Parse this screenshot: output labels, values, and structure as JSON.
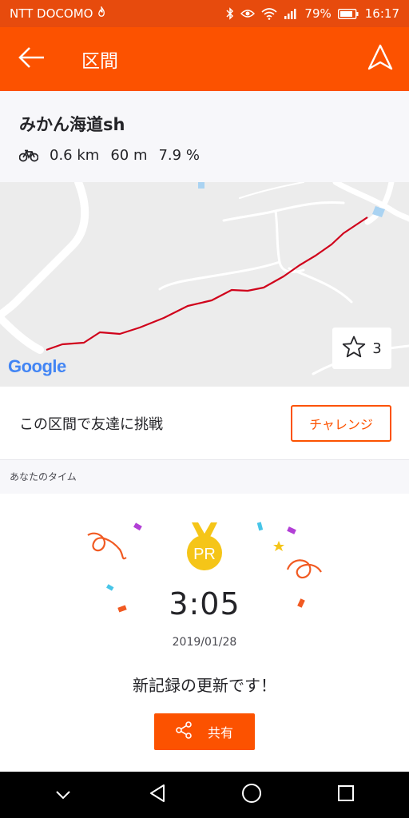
{
  "status_bar": {
    "carrier": "NTT DOCOMO",
    "battery": "79%",
    "time": "16:17"
  },
  "app_bar": {
    "title": "区間",
    "back_icon": "arrow-left-icon",
    "navigate_icon": "navigation-arrow-icon",
    "color": "#fc5200"
  },
  "segment": {
    "name": "みかん海道sh",
    "sport_icon": "bicycle-icon",
    "distance": "0.6 km",
    "elevation": "60 m",
    "grade": "7.9 %"
  },
  "map": {
    "attribution": "Google",
    "star_count": "3",
    "route_color": "#d0021b"
  },
  "challenge": {
    "text": "この区間で友達に挑戦",
    "button_label": "チャレンジ"
  },
  "section_label": "あなたのタイム",
  "result": {
    "badge": "PR",
    "time": "3:05",
    "date": "2019/01/28",
    "message": "新記録の更新です！",
    "share_label": "共有",
    "share_icon": "share-icon"
  }
}
